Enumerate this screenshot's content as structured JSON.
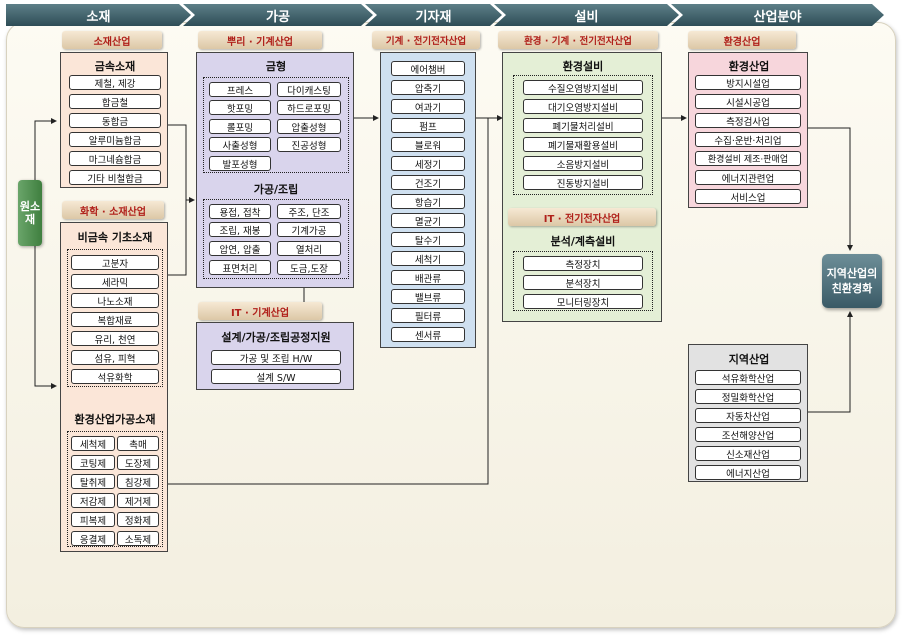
{
  "stages": [
    "소재",
    "가공",
    "기자재",
    "설비",
    "산업분야"
  ],
  "source": "원소재",
  "goal": "지역산업의 친환경화",
  "sections": {
    "metal": {
      "tab": "소재산업",
      "title": "금속소재",
      "items": [
        "제철, 제강",
        "합금철",
        "동합금",
        "알루미늄합금",
        "마그네슘합금",
        "기타 비철합금"
      ]
    },
    "nonmetal": {
      "tab": "화학 · 소재산업",
      "title": "비금속 기초소재",
      "items": [
        "고분자",
        "세라믹",
        "나노소재",
        "복합재료",
        "유리, 천연",
        "섬유, 피혁",
        "석유화학"
      ]
    },
    "envmat": {
      "title": "환경산업가공소재",
      "items": [
        "세척제",
        "촉매",
        "코팅제",
        "도장제",
        "탈취제",
        "침강제",
        "저감제",
        "제거제",
        "피복제",
        "정화제",
        "응결제",
        "소독제"
      ]
    },
    "mold": {
      "tab": "뿌리 · 기계산업",
      "title": "금형",
      "items": [
        "프레스",
        "다이캐스팅",
        "핫포밍",
        "하드로포밍",
        "롤포밍",
        "압출성형",
        "사출성형",
        "진공성형",
        "발포성형"
      ]
    },
    "process": {
      "title": "가공/조립",
      "items": [
        "용접, 접착",
        "주조, 단조",
        "조립, 재봉",
        "기계가공",
        "압연, 압출",
        "열처리",
        "표면처리",
        "도금,도장"
      ]
    },
    "it": {
      "tab": "IT · 기계산업",
      "title": "설계/가공/조립공정지원",
      "items": [
        "가공 및 조립 H/W",
        "설계 S/W"
      ]
    },
    "equipment": {
      "tab": "기계 · 전기전자산업",
      "items": [
        "에어챔버",
        "압축기",
        "여과기",
        "펌프",
        "블로워",
        "세정기",
        "건조기",
        "항습기",
        "멸균기",
        "탈수기",
        "세척기",
        "배관류",
        "밸브류",
        "필터류",
        "센서류"
      ]
    },
    "envfac": {
      "tab": "환경 · 기계 · 전기전자산업",
      "title": "환경설비",
      "items": [
        "수질오염방지설비",
        "대기오염방지설비",
        "폐기물처리설비",
        "폐기물재활용설비",
        "소음방지설비",
        "진동방지설비"
      ]
    },
    "measure": {
      "tab": "IT · 전기전자산업",
      "title": "분석/계측설비",
      "items": [
        "측정장치",
        "분석장치",
        "모니터링장치"
      ]
    },
    "envind": {
      "tab": "환경산업",
      "title": "환경산업",
      "items": [
        "방지시설업",
        "시설시공업",
        "측정검사업",
        "수집·운반·처리업",
        "환경설비 제조·판매업",
        "에너지관련업",
        "서비스업"
      ]
    },
    "region": {
      "title": "지역산업",
      "items": [
        "석유화학산업",
        "정밀화학산업",
        "자동차산업",
        "조선해양산업",
        "신소재산업",
        "에너지산업"
      ]
    }
  }
}
